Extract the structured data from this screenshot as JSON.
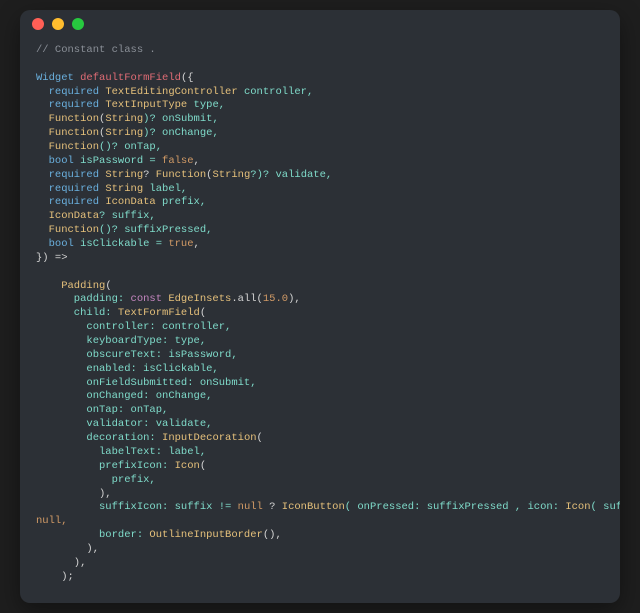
{
  "titlebar": {
    "close": "close",
    "minimize": "minimize",
    "zoom": "zoom"
  },
  "code": {
    "l1": "// Constant class .",
    "l3a": "Widget",
    "l3b": " defaultFormField",
    "l3c": "({",
    "l4a": "  required ",
    "l4b": "TextEditingController",
    "l4c": " controller,",
    "l5a": "  required ",
    "l5b": "TextInputType",
    "l5c": " type,",
    "l6a": "  Function",
    "l6b": "(",
    "l6c": "String",
    "l6d": ")? onSubmit,",
    "l7a": "  Function",
    "l7b": "(",
    "l7c": "String",
    "l7d": ")? onChange,",
    "l8a": "  Function",
    "l8b": "()? onTap,",
    "l9a": "  bool",
    "l9b": " isPassword = ",
    "l9c": "false",
    "l9d": ",",
    "l10a": "  required ",
    "l10b": "String",
    "l10c": "? ",
    "l10d": "Function",
    "l10e": "(",
    "l10f": "String",
    "l10g": "?)? validate,",
    "l11a": "  required ",
    "l11b": "String",
    "l11c": " label,",
    "l12a": "  required ",
    "l12b": "IconData",
    "l12c": " prefix,",
    "l13a": "  IconData",
    "l13b": "? suffix,",
    "l14a": "  Function",
    "l14b": "()? suffixPressed,",
    "l15a": "  bool",
    "l15b": " isClickable = ",
    "l15c": "true",
    "l15d": ",",
    "l16": "}) =>",
    "l18a": "    Padding",
    "l18b": "(",
    "l19a": "      padding: ",
    "l19b": "const ",
    "l19c": "EdgeInsets",
    "l19d": ".all(",
    "l19e": "15.0",
    "l19f": "),",
    "l20a": "      child: ",
    "l20b": "TextFormField",
    "l20c": "(",
    "l21": "        controller: controller,",
    "l22": "        keyboardType: type,",
    "l23": "        obscureText: isPassword,",
    "l24": "        enabled: isClickable,",
    "l25": "        onFieldSubmitted: onSubmit,",
    "l26": "        onChanged: onChange,",
    "l27": "        onTap: onTap,",
    "l28": "        validator: validate,",
    "l29a": "        decoration: ",
    "l29b": "InputDecoration",
    "l29c": "(",
    "l30": "          labelText: label,",
    "l31a": "          prefixIcon: ",
    "l31b": "Icon",
    "l31c": "(",
    "l32": "            prefix,",
    "l33": "          ),",
    "l34a": "          suffixIcon: suffix != ",
    "l34b": "null",
    "l34c": " ? ",
    "l34d": "IconButton",
    "l34e": "( onPressed: suffixPressed , icon: ",
    "l34f": "Icon",
    "l34g": "( suffix,),)  : ",
    "l35": "null,",
    "l36a": "          border: ",
    "l36b": "OutlineInputBorder",
    "l36c": "(),",
    "l37": "        ),",
    "l38": "      ),",
    "l39": "    );"
  }
}
